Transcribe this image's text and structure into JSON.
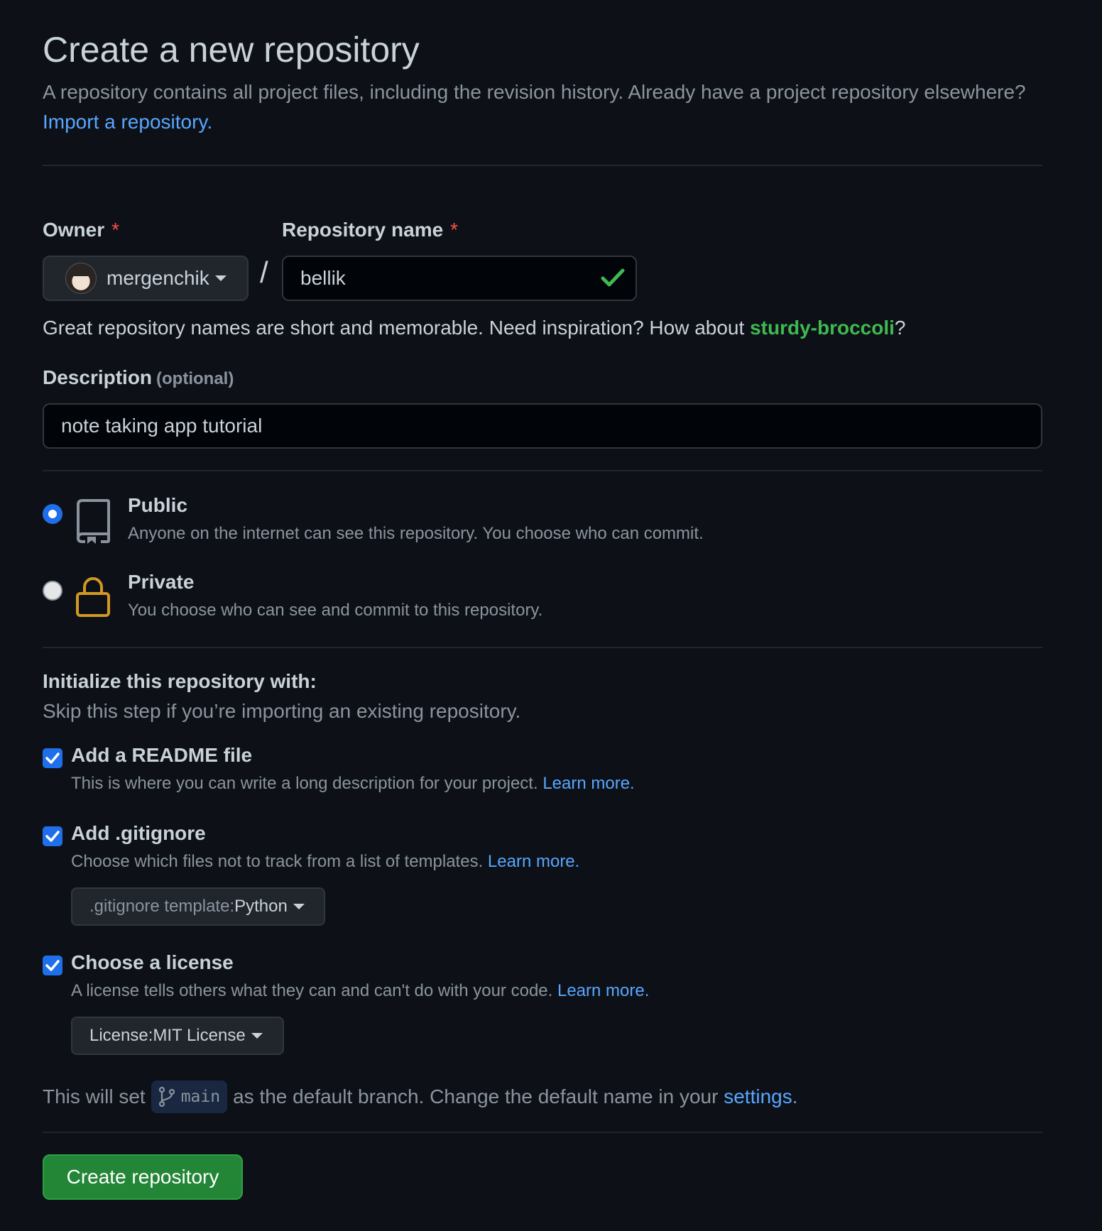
{
  "header": {
    "title": "Create a new repository",
    "subtitle": "A repository contains all project files, including the revision history. Already have a project repository elsewhere?",
    "import_link": "Import a repository."
  },
  "owner": {
    "label": "Owner",
    "required_mark": "*",
    "value": "mergenchik",
    "icon": "avatar"
  },
  "repo_name": {
    "label": "Repository name",
    "required_mark": "*",
    "value": "bellik",
    "valid_icon": "check-icon",
    "separator": "/"
  },
  "name_hint": {
    "text": "Great repository names are short and memorable. Need inspiration? How about ",
    "suggestion": "sturdy-broccoli",
    "suffix": "?"
  },
  "description": {
    "label": "Description",
    "optional": "(optional)",
    "value": "note taking app tutorial"
  },
  "visibility": {
    "selected": "Public",
    "options": [
      {
        "title": "Public",
        "desc": "Anyone on the internet can see this repository. You choose who can commit.",
        "icon": "repo-icon"
      },
      {
        "title": "Private",
        "desc": "You choose who can see and commit to this repository.",
        "icon": "lock-icon"
      }
    ]
  },
  "init": {
    "title": "Initialize this repository with:",
    "subtitle": "Skip this step if you’re importing an existing repository.",
    "options": [
      {
        "title": "Add a README file",
        "desc": "This is where you can write a long description for your project.",
        "link": "Learn more.",
        "checked": true
      },
      {
        "title": "Add .gitignore",
        "desc": "Choose which files not to track from a list of templates.",
        "link": "Learn more.",
        "checked": true
      },
      {
        "title": "Choose a license",
        "desc": "A license tells others what they can and can't do with your code.",
        "link": "Learn more.",
        "checked": true
      }
    ],
    "gitignore_select": {
      "prefix": ".gitignore template: ",
      "value": "Python"
    },
    "license_select": {
      "prefix": "License: ",
      "value": "MIT License"
    }
  },
  "branch": {
    "prefix": "This will set",
    "name": "main",
    "middle": "as the default branch. Change the default name in your",
    "link": "settings",
    "suffix": "."
  },
  "submit": {
    "label": "Create repository"
  },
  "colors": {
    "background": "#0d1117",
    "link": "#58a6ff",
    "success": "#3fb950",
    "primary_button": "#238636",
    "checkbox": "#1f6feb",
    "lock": "#d29922"
  }
}
